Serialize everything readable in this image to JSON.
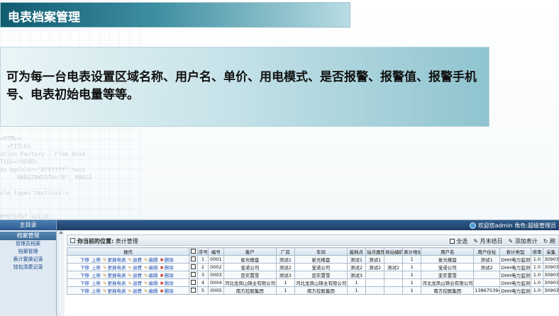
{
  "slide": {
    "title": "电表档案管理",
    "description": "可为每一台电表设置区域名称、用户名、单价、用电模式、是否报警、报警值、报警手机号、电表初始电量等等。"
  },
  "app": {
    "main_menu": "主目录",
    "section": "档案管理",
    "sidebar_links": [
      "管理员档案",
      "档案管理",
      "表计置换记录",
      "钱包清费记录"
    ],
    "user_info": "欢迎您admin 角色:超级管理员",
    "location_label": "你当前的位置:",
    "location_value": "表计管理",
    "toolbar": {
      "select_all": "全选",
      "month_end": "月末结日",
      "add_meter": "添加表计",
      "refresh": "刷"
    },
    "table": {
      "headers": [
        "操作",
        "",
        "序号",
        "编号",
        "客户",
        "厂房",
        "车间",
        "能耗点",
        "站点属性",
        "局站编码",
        "表计地址",
        "用户名",
        "用户住址",
        "表计类型",
        "倍率",
        "采集"
      ],
      "op_labels": [
        "下移",
        "上移",
        "更换电表",
        "退费",
        "编辑",
        "删除"
      ],
      "rows": [
        [
          "1",
          "0001",
          "星光楼盘",
          "测试1",
          "星光楼盘",
          "测试1",
          "测试1",
          "",
          "1",
          "星光楼盘",
          "测试1",
          "DHH电力监测仪",
          "1.0",
          "30903"
        ],
        [
          "2",
          "0002",
          "宝诺公司",
          "测试2",
          "宝诺公司",
          "测试2",
          "测试2",
          "测试2",
          "1",
          "宝诺公司",
          "测试2",
          "DHH电力监测仪",
          "1.0",
          "30903"
        ],
        [
          "3",
          "0003",
          "亚实置雪",
          "测试3",
          "亚实置雪",
          "测试3",
          "",
          "",
          "1",
          "亚实置雪",
          "",
          "DHH电力监测仪",
          "1.0",
          "30903"
        ],
        [
          "4",
          "0004",
          "河北龙凤山铸业有限公司",
          "1",
          "河北龙凤山铸业有限公司",
          "1",
          "",
          "",
          "1",
          "河北龙凤山铸业有限公司",
          "",
          "DHH电力监测仪",
          "1.0",
          "30903"
        ],
        [
          "5",
          "0005",
          "南方控股集团",
          "1",
          "南方控股集团",
          "1",
          "",
          "",
          "1",
          "南方控股集团",
          "13867539429",
          "DHH电力监测仪",
          "1.0",
          "30903"
        ]
      ]
    }
  },
  "colors": {
    "title_bar": "#0f5b70",
    "panel": "#8fc4cf",
    "header": "#2f5b8a",
    "link": "#1f4fb2"
  }
}
